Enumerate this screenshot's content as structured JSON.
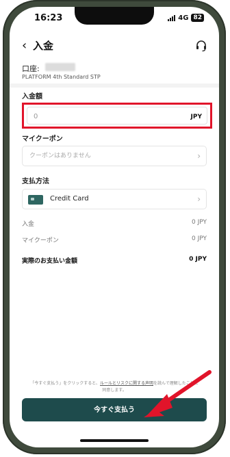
{
  "status": {
    "time": "16:23",
    "network": "4G",
    "battery": "82"
  },
  "header": {
    "back_icon": "chevron-left-icon",
    "title": "入金",
    "support_icon": "headset-icon"
  },
  "account": {
    "label": "口座:",
    "type": "PLATFORM 4th Standard STP"
  },
  "amount": {
    "label": "入金額",
    "placeholder": "0",
    "currency": "JPY"
  },
  "coupon": {
    "label": "マイクーポン",
    "placeholder": "クーポンはありません"
  },
  "payment": {
    "label": "支払方法",
    "method": "Credit Card"
  },
  "summary": {
    "deposit_label": "入金",
    "deposit_value": "0 JPY",
    "coupon_label": "マイクーポン",
    "coupon_value": "0 JPY",
    "total_label": "実際のお支払い金額",
    "total_value": "0 JPY"
  },
  "disclaimer": {
    "prefix": "「今すぐ支払う」をクリックすると、",
    "link": "ルールとリスクに関する声明",
    "suffix": "を読んで理解したことに同意します。"
  },
  "pay_button": "今すぐ支払う",
  "colors": {
    "highlight": "#e1142a",
    "button": "#1e4b4c",
    "arrow": "#e1142a"
  }
}
